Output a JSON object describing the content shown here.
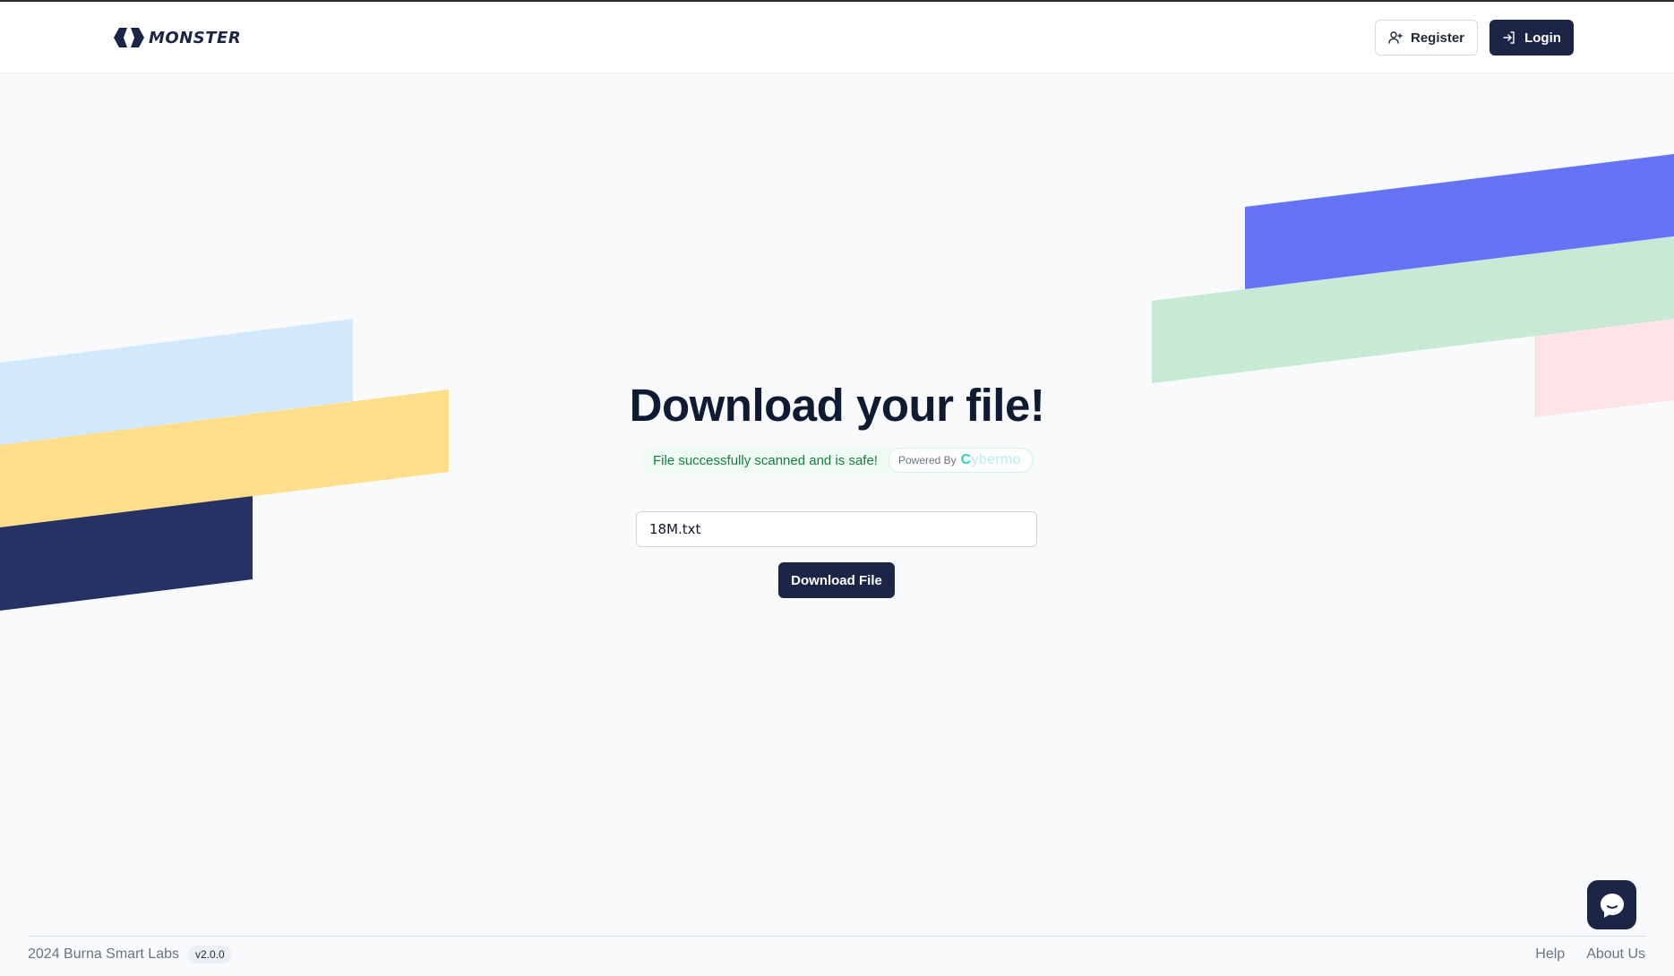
{
  "header": {
    "brand": "MONSTER",
    "register_label": "Register",
    "login_label": "Login"
  },
  "main": {
    "title": "Download your file!",
    "scan_status": "File successfully scanned and is safe!",
    "powered_by_label": "Powered By",
    "powered_by_brand_initial": "C",
    "powered_by_brand_rest": "ybermo",
    "file_name": "18M.txt",
    "download_label": "Download File"
  },
  "footer": {
    "copyright": "2024 Burna Smart Labs",
    "version": "v2.0.0",
    "links": [
      "Help",
      "About Us"
    ]
  },
  "icons": {
    "brand": "monster-logo-icon",
    "register": "user-plus-icon",
    "login": "login-icon",
    "chat": "chat-bubble-icon"
  },
  "colors": {
    "primary": "#1d2547",
    "success_text": "#15803d",
    "success_bg": "#eefaf2",
    "background": "#f9fafc",
    "deco_light_blue": "#d4e8fc",
    "deco_yellow": "#ffde8c",
    "deco_navy": "#263263",
    "deco_indigo": "#6474f4",
    "deco_mint": "#c8e9d6",
    "deco_pink": "#fde4e6"
  }
}
